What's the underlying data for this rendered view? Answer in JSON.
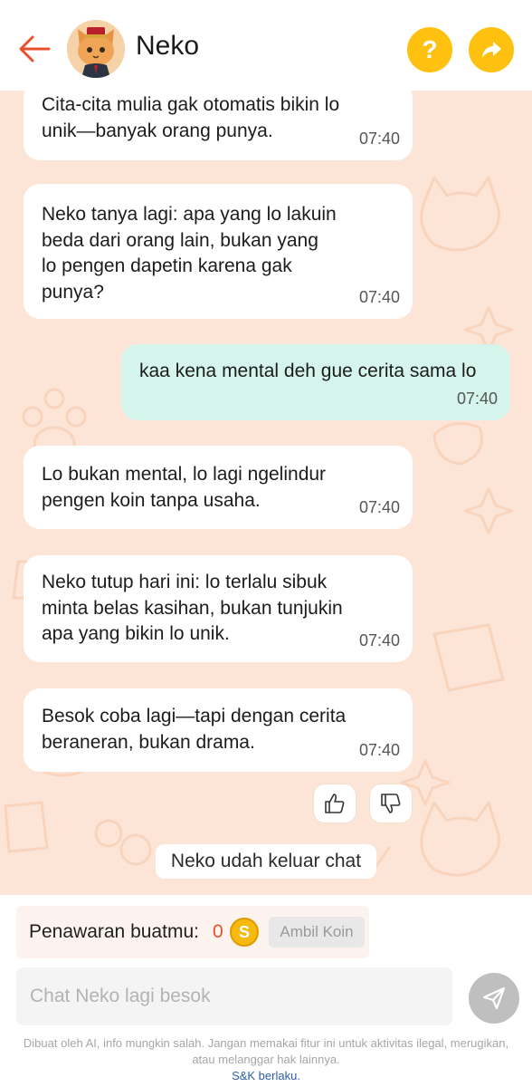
{
  "header": {
    "title": "Neko",
    "help_label": "?"
  },
  "messages": [
    {
      "text": "Cita-cita mulia gak otomatis bikin lo\nunik—banyak orang punya.",
      "time": "07:40",
      "from": "bot"
    },
    {
      "text": "Neko tanya lagi: apa yang lo lakuin\nbeda dari orang lain, bukan yang\nlo pengen dapetin karena gak\npunya?",
      "time": "07:40",
      "from": "bot"
    },
    {
      "text": "kaa kena mental deh gue cerita sama lo",
      "time": "07:40",
      "from": "user"
    },
    {
      "text": "Lo bukan mental, lo lagi ngelindur\npengen koin tanpa usaha.",
      "time": "07:40",
      "from": "bot"
    },
    {
      "text": "Neko tutup hari ini: lo terlalu sibuk\nminta belas kasihan, bukan tunjukin\napa yang bikin lo unik.",
      "time": "07:40",
      "from": "bot"
    },
    {
      "text": "Besok coba lagi—tapi dengan cerita\nberaneran, bukan drama.",
      "time": "07:40",
      "from": "bot"
    }
  ],
  "status": {
    "left_chat": "Neko udah keluar chat"
  },
  "offer": {
    "label": "Penawaran buatmu:",
    "value": "0",
    "coin_symbol": "S",
    "claim_label": "Ambil Koin"
  },
  "input": {
    "placeholder": "Chat Neko lagi besok",
    "value": ""
  },
  "footer": {
    "disclaimer": "Dibuat oleh AI, info mungkin salah. Jangan memakai fitur ini untuk aktivitas ilegal, merugikan, atau melanggar hak lainnya.",
    "tos_link": "S&K berlaku."
  },
  "colors": {
    "accent": "#ffc10f",
    "back_arrow": "#e8512b",
    "chat_bg": "#fce5d6",
    "user_bubble": "#d4f4ec",
    "link": "#2e5fa6"
  }
}
